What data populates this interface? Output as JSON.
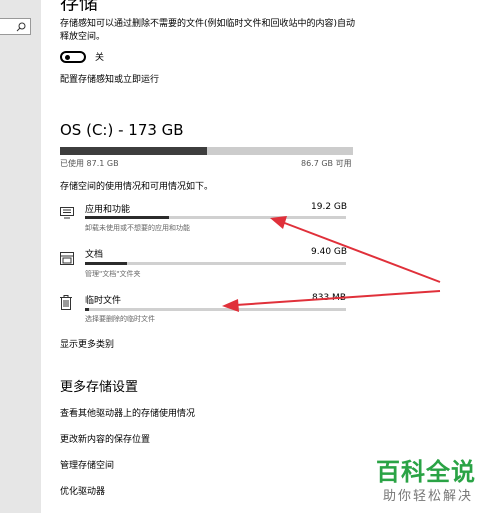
{
  "sidebar": {
    "search_icon": "search-icon"
  },
  "storage_sense": {
    "title": "存储",
    "description": "存储感知可以通过删除不需要的文件(例如临时文件和回收站中的内容)自动释放空间。",
    "toggle_state": "关",
    "toggle_on": false,
    "configure_link": "配置存储感知或立即运行"
  },
  "drive": {
    "title": "OS (C:) - 173 GB",
    "used_label": "已使用 87.1 GB",
    "free_label": "86.7 GB 可用",
    "used_fraction": 0.5,
    "caption": "存储空间的使用情况和可用情况如下。"
  },
  "categories": [
    {
      "icon": "apps-icon",
      "name": "应用和功能",
      "size": "19.2 GB",
      "desc": "卸载未使用或不想要的应用和功能",
      "fraction": 0.32
    },
    {
      "icon": "documents-icon",
      "name": "文档",
      "size": "9.40 GB",
      "desc": "管理\"文档\"文件夹",
      "fraction": 0.16
    },
    {
      "icon": "trash-icon",
      "name": "临时文件",
      "size": "833 MB",
      "desc": "选择要删除的临时文件",
      "fraction": 0.015
    }
  ],
  "show_more": "显示更多类别",
  "more_settings": {
    "heading": "更多存储设置",
    "links": [
      "查看其他驱动器上的存储使用情况",
      "更改新内容的保存位置",
      "管理存储空间",
      "优化驱动器"
    ]
  },
  "watermark": {
    "title": "百科全说",
    "subtitle": "助你轻松解决"
  },
  "colors": {
    "accent_arrow": "#e0303a",
    "watermark_green": "#2aa345"
  }
}
